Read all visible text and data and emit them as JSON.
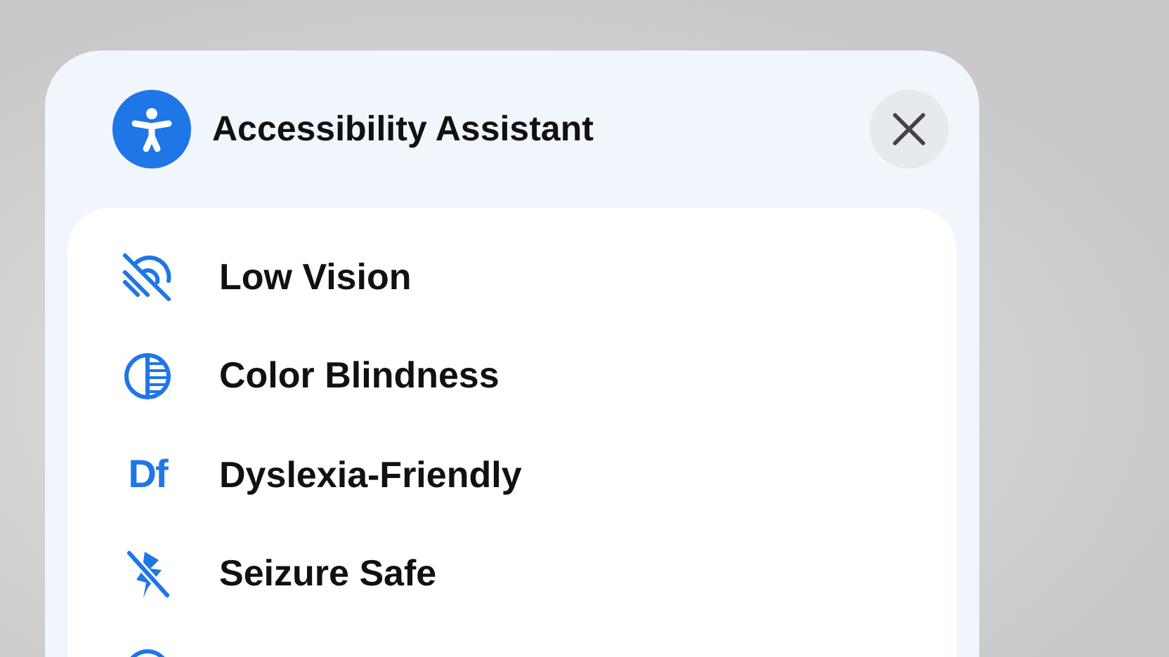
{
  "panel": {
    "title": "Accessibility Assistant"
  },
  "options": [
    {
      "kind": "eye-off",
      "label": "Low Vision"
    },
    {
      "kind": "contrast",
      "label": "Color Blindness"
    },
    {
      "kind": "text",
      "glyph": "Df",
      "label": "Dyslexia-Friendly"
    },
    {
      "kind": "flash-off",
      "label": "Seizure Safe"
    },
    {
      "kind": "ring"
    }
  ]
}
